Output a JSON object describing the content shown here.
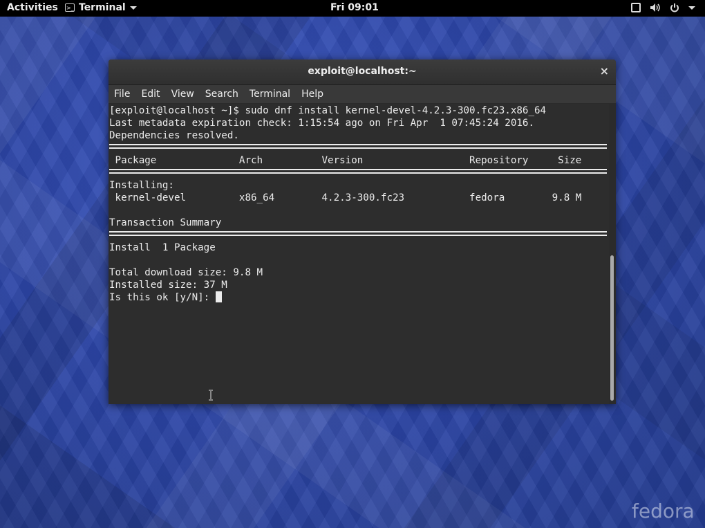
{
  "topbar": {
    "activities": "Activities",
    "app_name": "Terminal",
    "clock": "Fri 09:01",
    "icons": [
      "screen-icon",
      "volume-icon",
      "power-icon",
      "chevron-down-icon"
    ]
  },
  "window": {
    "title": "exploit@localhost:~",
    "close": "×",
    "menu": [
      "File",
      "Edit",
      "View",
      "Search",
      "Terminal",
      "Help"
    ]
  },
  "terminal": {
    "lines": [
      "[exploit@localhost ~]$ sudo dnf install kernel-devel-4.2.3-300.fc23.x86_64",
      "Last metadata expiration check: 1:15:54 ago on Fri Apr  1 07:45:24 2016.",
      "Dependencies resolved.",
      " Package              Arch          Version                  Repository     Size",
      "Installing:",
      " kernel-devel         x86_64        4.2.3-300.fc23           fedora        9.8 M",
      "Transaction Summary",
      "Install  1 Package",
      "Total download size: 9.8 M",
      "Installed size: 37 M",
      "Is this ok [y/N]: "
    ]
  },
  "desktop": {
    "logo_text": "fedora",
    "background_color": "#2d46a8"
  }
}
